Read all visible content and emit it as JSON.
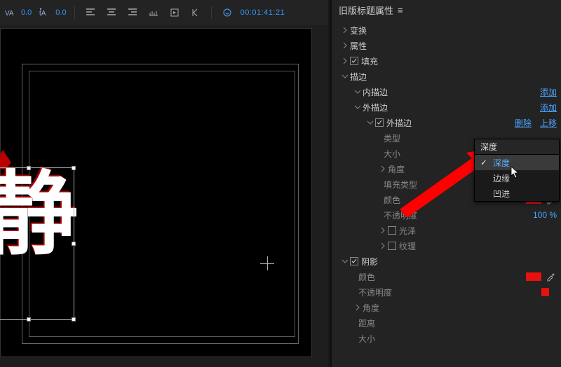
{
  "toolbar": {
    "va_value": "0.0",
    "ta_value": "0.0",
    "timecode": "00:01:41:21"
  },
  "canvas": {
    "title_glyph": "静"
  },
  "panel": {
    "title": "旧版标题属性"
  },
  "tree": {
    "transform": "变换",
    "properties": "属性",
    "fill": "填充",
    "stroke": "描边",
    "inner_stroke": "内描边",
    "outer_stroke": "外描边",
    "outer_stroke_item": "外描边",
    "type": "类型",
    "size": "大小",
    "angle": "角度",
    "fill_type": "填充类型",
    "color": "颜色",
    "opacity": "不透明度",
    "sheen": "光泽",
    "texture": "纹理",
    "shadow": "阴影",
    "shadow_color": "颜色",
    "shadow_opacity": "不透明度",
    "shadow_angle": "角度",
    "distance": "距离",
    "shadow_size": "大小",
    "opacity_value": "100 %"
  },
  "actions": {
    "add": "添加",
    "delete": "删除",
    "move_up": "上移"
  },
  "dropdown": {
    "current": "深度",
    "options": [
      "深度",
      "边缘",
      "凹进"
    ],
    "selected_index": 0
  }
}
